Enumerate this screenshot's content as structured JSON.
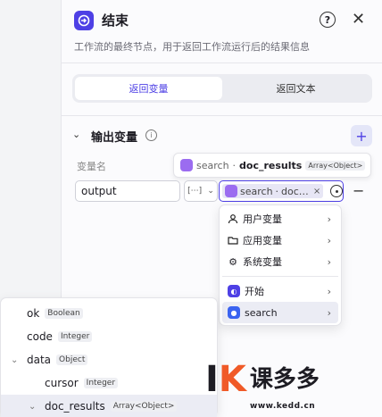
{
  "header": {
    "title": "结束",
    "description": "工作流的最终节点，用于返回工作流运行后的结果信息",
    "help_glyph": "?",
    "close_glyph": "✕"
  },
  "tabs": [
    {
      "label": "返回变量",
      "active": true
    },
    {
      "label": "返回文本",
      "active": false
    }
  ],
  "output_section": {
    "title": "输出变量",
    "column_label": "变量名",
    "add_glyph": "+",
    "remove_glyph": "−"
  },
  "variable_row": {
    "name_value": "output",
    "type_glyph": "[⋯]",
    "ref_node": "search",
    "ref_separator": "·",
    "ref_field_short": "doc…",
    "clear_glyph": "×"
  },
  "tooltip": {
    "node": "search",
    "separator": "·",
    "field": "doc_results",
    "type": "Array<Object>"
  },
  "menu": {
    "items": [
      {
        "label": "用户变量",
        "icon": "user-icon"
      },
      {
        "label": "应用变量",
        "icon": "folder-icon"
      },
      {
        "label": "系统变量",
        "icon": "gear-icon"
      }
    ],
    "nodes": [
      {
        "label": "开始",
        "icon": "start-node-icon"
      },
      {
        "label": "search",
        "icon": "search-node-icon"
      }
    ]
  },
  "tree": {
    "items": [
      {
        "name": "ok",
        "type": "Boolean"
      },
      {
        "name": "code",
        "type": "Integer"
      },
      {
        "name": "data",
        "type": "Object"
      },
      {
        "name": "cursor",
        "type": "Integer"
      },
      {
        "name": "doc_results",
        "type": "Array<Object>"
      }
    ]
  },
  "watermark": {
    "brand": "课多多",
    "url": "www.kedd.cn",
    "accent_color": "#f05a28"
  },
  "colors": {
    "primary": "#4e40e5",
    "node_purple": "#9b6cf0",
    "node_blue": "#3b63f0"
  }
}
